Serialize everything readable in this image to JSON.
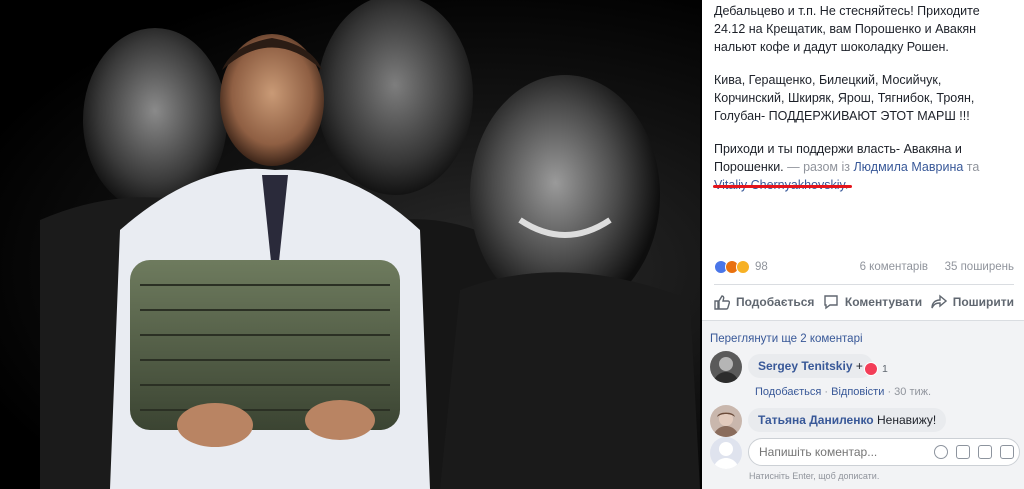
{
  "post": {
    "line1": "Дебальцево и т.п. Не стесняйтесь! Приходите",
    "line2": "24.12 на Крещатик, вам Порошенко и Авакян",
    "line3": "нальют кофе и дадут шоколадку Рошен.",
    "para2_line1": "Кива, Геращенко, Билецкий, Мосийчук,",
    "para2_line2": "Корчинский, Шкиряк, Ярош, Тягнибок, Троян,",
    "para2_line3": "Голубан- ПОДДЕРЖИВАЮТ ЭТОТ МАРШ !!!",
    "para3_line1": "Приходи и ты поддержи власть- Авакяна и",
    "para3_line2": "Порошенки.",
    "with_prefix": " — разом із ",
    "tag1": "Людмила Маврина",
    "tag_sep": " та ",
    "tag2": "Vitaliy Chernyakhovskiy",
    "tag_end": "."
  },
  "reactions": {
    "count": "98",
    "comments": "6 коментарів",
    "shares": "35 поширень",
    "icons": [
      "like-icon",
      "angry-icon",
      "haha-icon"
    ]
  },
  "actions": {
    "like": "Подобається",
    "comment": "Коментувати",
    "share": "Поширити"
  },
  "comments": {
    "more": "Переглянути ще 2 коментарі",
    "items": [
      {
        "author": "Sergey Tenitskiy",
        "text": "+",
        "reaction_count": "1",
        "like_label": "Подобається",
        "reply_label": "Відповісти",
        "time": "30 тиж."
      },
      {
        "author": "Татьяна Даниленко",
        "text": "Ненавижу!"
      }
    ],
    "composer_placeholder": "Напишіть коментар...",
    "composer_hint": "Натисніть Enter, щоб дописати."
  },
  "colors": {
    "link": "#385898",
    "muted": "#90949c",
    "underline": "#e4151c"
  }
}
